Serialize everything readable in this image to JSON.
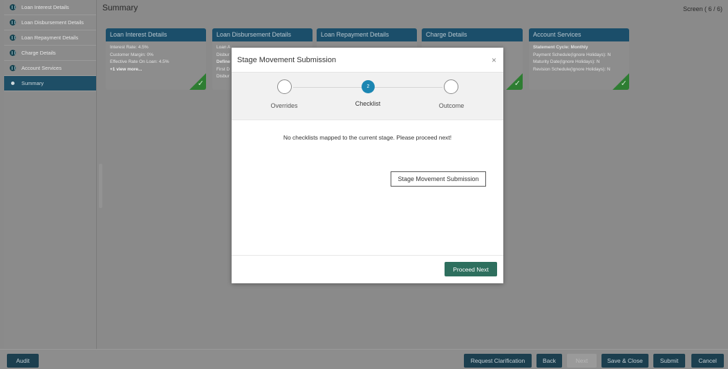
{
  "sidebar": {
    "items": [
      {
        "label": "Loan Interest Details"
      },
      {
        "label": "Loan Disbursement Details"
      },
      {
        "label": "Loan Repayment Details"
      },
      {
        "label": "Charge Details"
      },
      {
        "label": "Account Services"
      },
      {
        "label": "Summary"
      }
    ]
  },
  "header": {
    "title": "Summary",
    "screen_label": "Screen ( 6 / 6)"
  },
  "cards": [
    {
      "title": "Loan Interest Details",
      "lines": [
        "Interest Rate: 4.5%",
        "Customer Margin: 0%",
        "Effective Rate On Loan: 4.5%"
      ],
      "more": "+1 view more..."
    },
    {
      "title": "Loan Disbursement Details",
      "lines": [
        "Loan A",
        "Disbur",
        "Define",
        "First D",
        "Disbur"
      ]
    },
    {
      "title": "Loan Repayment Details",
      "lines": []
    },
    {
      "title": "Charge Details",
      "lines": []
    },
    {
      "title": "Account Services",
      "lines": [
        "Statement Cycle: Monthly",
        "Payment Schedule(Ignore Holidays): N",
        "Maturity Date(Ignore Holidays): N",
        "Revision Schedule(Ignore Holidays): N"
      ]
    }
  ],
  "modal": {
    "title": "Stage Movement Submission",
    "close_icon": "×",
    "steps": [
      {
        "label": "Overrides",
        "state": "pending"
      },
      {
        "label": "Checklist",
        "state": "active",
        "number": "2"
      },
      {
        "label": "Outcome",
        "state": "pending"
      }
    ],
    "message": "No checklists mapped to the current stage. Please proceed next!",
    "tooltip": "Stage Movement Submission",
    "proceed_label": "Proceed Next",
    "proceed_color": "#2e6f5e",
    "active_step_color": "#1b86b2"
  },
  "footer": {
    "audit": "Audit",
    "request_clarification": "Request Clarification",
    "back": "Back",
    "next": "Next",
    "save_close": "Save & Close",
    "submit": "Submit",
    "cancel": "Cancel"
  }
}
